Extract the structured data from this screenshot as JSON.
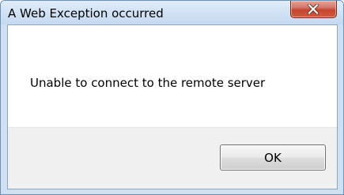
{
  "window": {
    "title": "A Web Exception occurred"
  },
  "message": {
    "text": "Unable to connect to the remote server"
  },
  "buttons": {
    "ok_label": "OK"
  },
  "icons": {
    "close": "close-icon"
  },
  "colors": {
    "close_button": "#c7452f",
    "title_bar": "#d3e3f5"
  }
}
